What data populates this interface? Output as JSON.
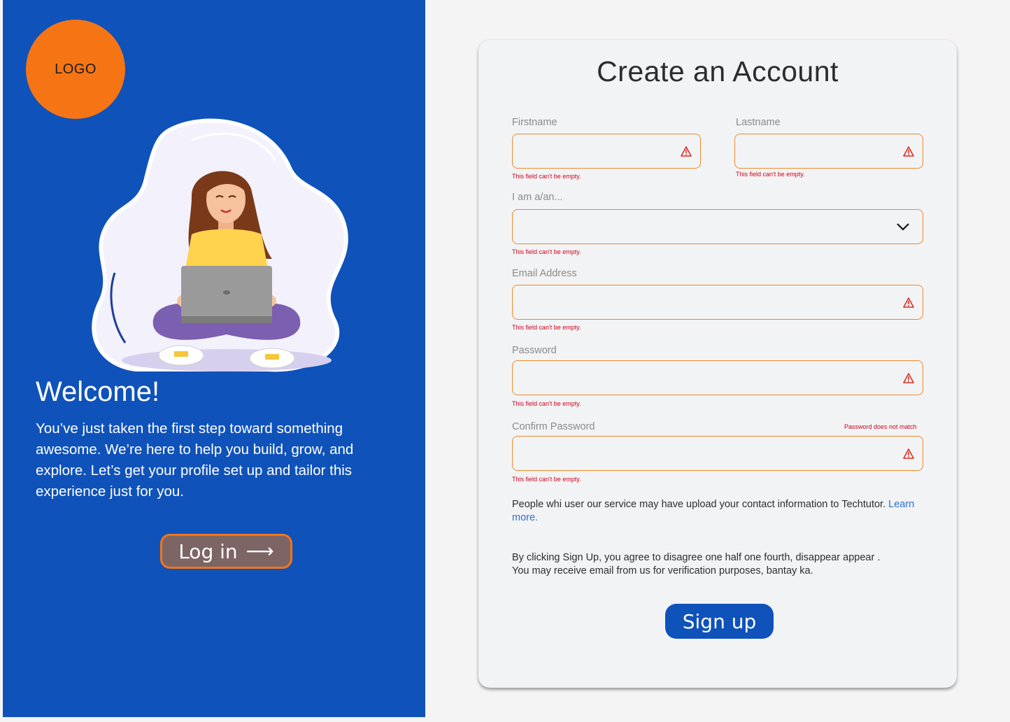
{
  "logo": {
    "text": "LOGO"
  },
  "welcome": {
    "title": "Welcome!",
    "body": "You’ve just taken the first step toward something awesome. We’re here to help you build, grow, and explore. Let’s get your profile set up and tailor this experience just for you.",
    "login_label": "Log in",
    "login_arrow": "⟶"
  },
  "form": {
    "title": "Create an Account",
    "firstname": {
      "label": "Firstname",
      "value": "",
      "error": "This field can't be empty."
    },
    "lastname": {
      "label": "Lastname",
      "value": "",
      "error": "This field can't be empty."
    },
    "role": {
      "label": "I am a/an...",
      "value": "",
      "error": "This field can't be empty."
    },
    "email": {
      "label": "Email Address",
      "value": "",
      "error": "This field can't be empty."
    },
    "password": {
      "label": "Password",
      "value": "",
      "error": "This field can't be empty."
    },
    "confirm_password": {
      "label": "Confirm Password",
      "value": "",
      "error": "This field can't be empty.",
      "mismatch": "Password does not match"
    },
    "contact_notice": "People whi user our  service may have upload your contact information to Techtutor.",
    "learn_more": "Learn more.",
    "agreement_line1": "By clicking Sign Up, you agree to disagree one half one fourth, disappear appear .",
    "agreement_line2": "You may receive email from us for verification purposes, bantay ka.",
    "signup_label": "Sign up"
  },
  "icons": {
    "field_error": "warning-triangle-icon",
    "dropdown": "chevron-down-icon",
    "login_arrow": "arrow-right-icon"
  },
  "colors": {
    "brand_blue": "#0f52ba",
    "logo_orange": "#f57514",
    "field_border": "#f08a2a",
    "error_red": "#d0021b",
    "login_button": "#7d6565",
    "link": "#2f6fd0"
  }
}
